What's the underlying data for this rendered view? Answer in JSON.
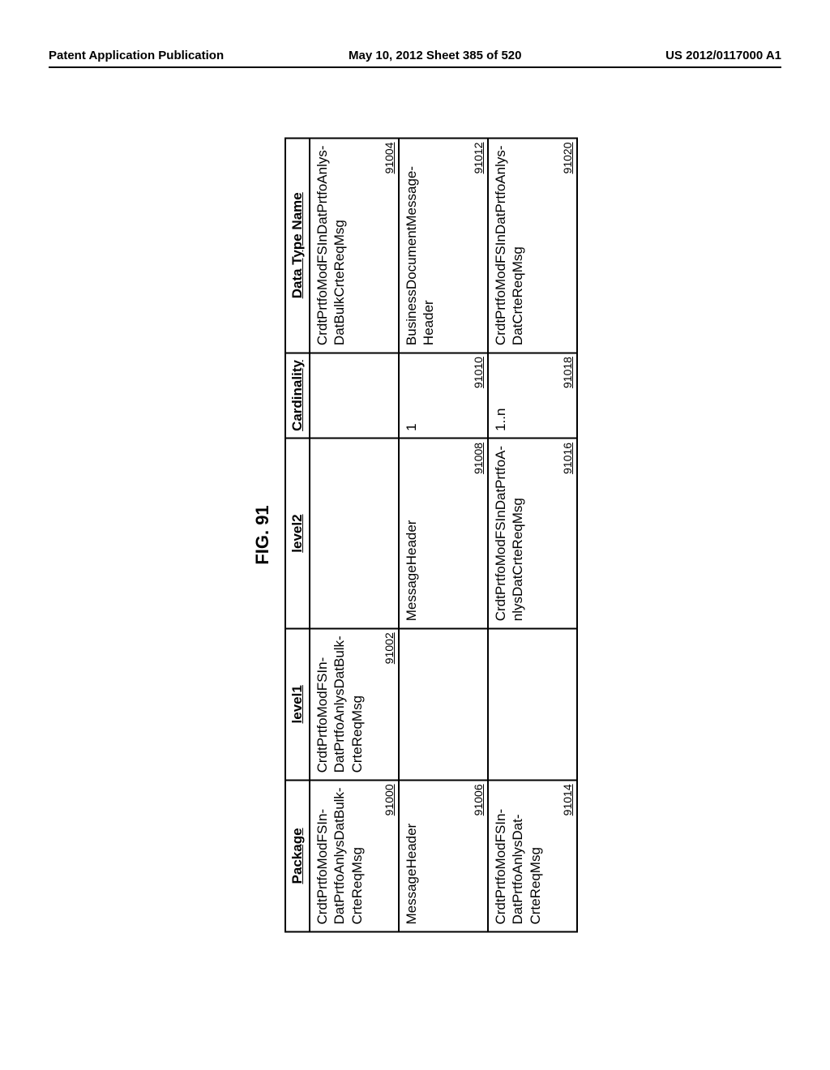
{
  "header": {
    "left": "Patent Application Publication",
    "center": "May 10, 2012  Sheet 385 of 520",
    "right": "US 2012/0117000 A1"
  },
  "figure_label": "FIG. 91",
  "columns": {
    "package": "Package",
    "level1": "level1",
    "level2": "level2",
    "cardinality": "Cardinality",
    "datatype": "Data Type Name"
  },
  "rows": [
    {
      "package": {
        "text": "CrdtPrtfoModFSIn-\nDatPrtfoAnlysDatBulk-\nCrteReqMsg",
        "id": "91000"
      },
      "level1": {
        "text": "CrdtPrtfoModFSIn-\nDatPrtfoAnlysDatBulk-\nCrteReqMsg",
        "id": "91002"
      },
      "level2": {
        "text": "",
        "id": ""
      },
      "card": {
        "text": "",
        "id": ""
      },
      "dtype": {
        "text": "CrdtPrtfoModFSInDatPrtfoAnlys-\nDatBulkCrteReqMsg",
        "id": "91004"
      }
    },
    {
      "package": {
        "text": "MessageHeader",
        "id": "91006"
      },
      "level1": {
        "text": "",
        "id": ""
      },
      "level2": {
        "text": "MessageHeader",
        "id": "91008"
      },
      "card": {
        "text": "1",
        "id": "91010"
      },
      "dtype": {
        "text": "BusinessDocumentMessage-\nHeader",
        "id": "91012"
      }
    },
    {
      "package": {
        "text": "CrdtPrtfoModFSIn-\nDatPrtfoAnlysDat-\nCrteReqMsg",
        "id": "91014"
      },
      "level1": {
        "text": "",
        "id": ""
      },
      "level2": {
        "text": "CrdtPrtfoModFSInDatPrtfoA-\nnlysDatCrteReqMsg",
        "id": "91016"
      },
      "card": {
        "text": "1..n",
        "id": "91018"
      },
      "dtype": {
        "text": "CrdtPrtfoModFSInDatPrtfoAnlys-\nDatCrteReqMsg",
        "id": "91020"
      }
    }
  ]
}
